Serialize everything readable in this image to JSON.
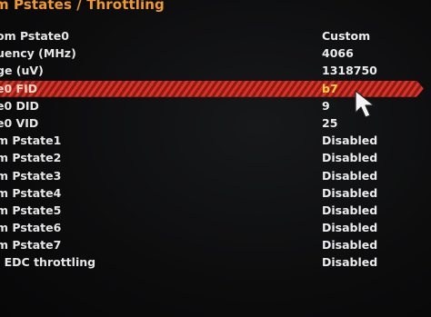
{
  "header": {
    "title": "m Pstates / Throttling"
  },
  "colors": {
    "accent_orange": "#f19a2b",
    "selected_bar": "#d8352a",
    "selected_value": "#ffd23a"
  },
  "settings": [
    {
      "label": "om Pstate0",
      "value": "Custom"
    },
    {
      "label": "uency (MHz)",
      "value": "4066"
    },
    {
      "label": "ge (uV)",
      "value": "1318750"
    },
    {
      "label": "e0 FID",
      "value": "b7"
    },
    {
      "label": "e0 DID",
      "value": "9"
    },
    {
      "label": "e0 VID",
      "value": "25"
    },
    {
      "label": "m Pstate1",
      "value": "Disabled"
    },
    {
      "label": "m Pstate2",
      "value": "Disabled"
    },
    {
      "label": "m Pstate3",
      "value": "Disabled"
    },
    {
      "label": "m Pstate4",
      "value": "Disabled"
    },
    {
      "label": "m Pstate5",
      "value": "Disabled"
    },
    {
      "label": "m Pstate6",
      "value": "Disabled"
    },
    {
      "label": "m Pstate7",
      "value": "Disabled"
    },
    {
      "label": "l EDC throttling",
      "value": "Disabled"
    }
  ],
  "cursor": {
    "icon": "mouse-pointer-icon"
  }
}
